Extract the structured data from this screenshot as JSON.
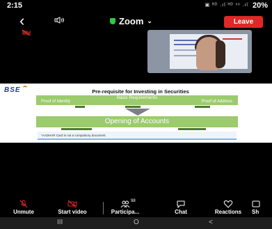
{
  "status": {
    "time": "2:15",
    "indicators": "▣ ᴴᴰ .ıl ᴴᴰ ᵛᵒ .ıl",
    "battery": "20%"
  },
  "topbar": {
    "back_icon": "chevron-left-icon",
    "speaker_icon": "speaker-icon",
    "title": "Zoom",
    "leave_label": "Leave",
    "colors": {
      "leave": "#e02828",
      "secure": "#2ecc40"
    }
  },
  "slide": {
    "logo": "BSE",
    "title": "Pre-requisite for Investing in Securities",
    "requirements_title": "Basic Requirements",
    "proof_identity": "Proof of Identity",
    "proof_address": "Proof of Address",
    "accounts": "Opening of Accounts",
    "aadhar_note": "*AADHAR Card is not a compulsory document."
  },
  "toolbar": {
    "unmute": "Unmute",
    "start_video": "Start video",
    "participants": "Participa...",
    "participants_count": "98",
    "chat": "Chat",
    "reactions": "Reactions",
    "share": "Sh"
  },
  "navbar": {
    "recents": "III",
    "home": "O",
    "back": "<"
  }
}
